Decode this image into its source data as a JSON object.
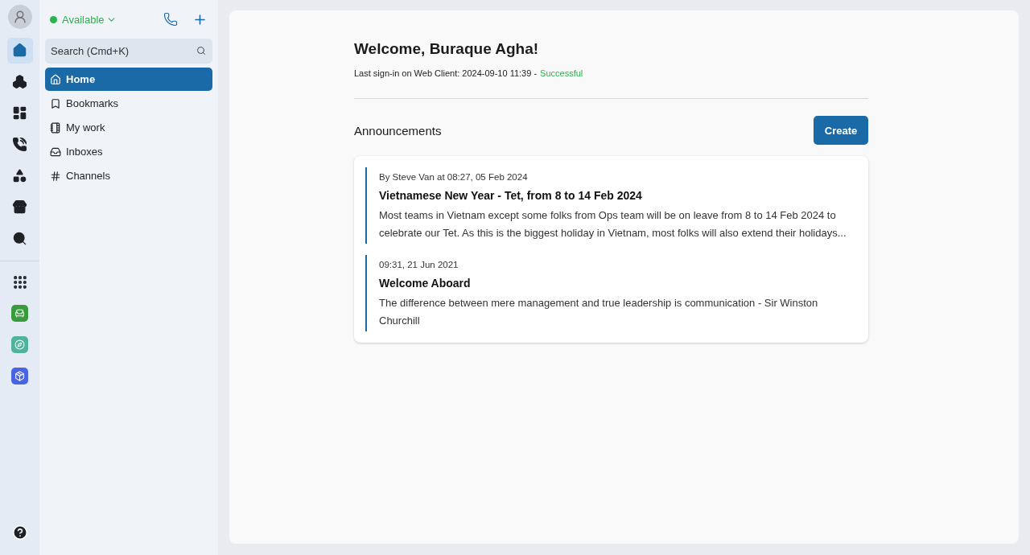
{
  "rail": {
    "items": [
      {
        "kind": "home",
        "selected": true
      },
      {
        "kind": "team",
        "selected": false
      },
      {
        "kind": "dashboard",
        "selected": false
      },
      {
        "kind": "calls",
        "selected": false
      },
      {
        "kind": "shapes",
        "selected": false
      },
      {
        "kind": "store",
        "selected": false
      },
      {
        "kind": "monitor",
        "selected": false
      }
    ],
    "apps": [
      {
        "kind": "grid"
      },
      {
        "kind": "green-app",
        "color": "#3a9a3e"
      },
      {
        "kind": "teal-app",
        "color": "#4fb39a"
      },
      {
        "kind": "blue-app",
        "color": "#4a63e0"
      }
    ]
  },
  "sidebar": {
    "status": "Available",
    "search": {
      "placeholder": "Search (Cmd+K)"
    },
    "items": [
      {
        "kind": "home",
        "label": "Home",
        "selected": true
      },
      {
        "kind": "bookmark",
        "label": "Bookmarks",
        "selected": false
      },
      {
        "kind": "list",
        "label": "My work",
        "selected": false
      },
      {
        "kind": "inbox",
        "label": "Inboxes",
        "selected": false
      },
      {
        "kind": "hash",
        "label": "Channels",
        "selected": false
      }
    ]
  },
  "main": {
    "title": "Welcome, Buraque Agha!",
    "last_signin": "Last sign-in on Web Client: 2024-09-10 11:39 -",
    "signin_status": "Successful",
    "announcements": {
      "heading": "Announcements",
      "create_button": "Create",
      "items": [
        {
          "meta": "By Steve Van at 08:27, 05 Feb 2024",
          "title": "Vietnamese New Year - Tet, from 8 to 14 Feb 2024",
          "body": "Most teams in Vietnam except some folks from Ops team will be on leave from 8 to 14 Feb 2024 to celebrate our Tet. As this is the biggest holiday in Vietnam, most folks will also extend their holidays..."
        },
        {
          "meta": "09:31, 21 Jun 2021",
          "title": "Welcome Aboard",
          "body": "The difference between mere management and true leadership is communication - Sir Winston Churchill"
        }
      ]
    }
  }
}
